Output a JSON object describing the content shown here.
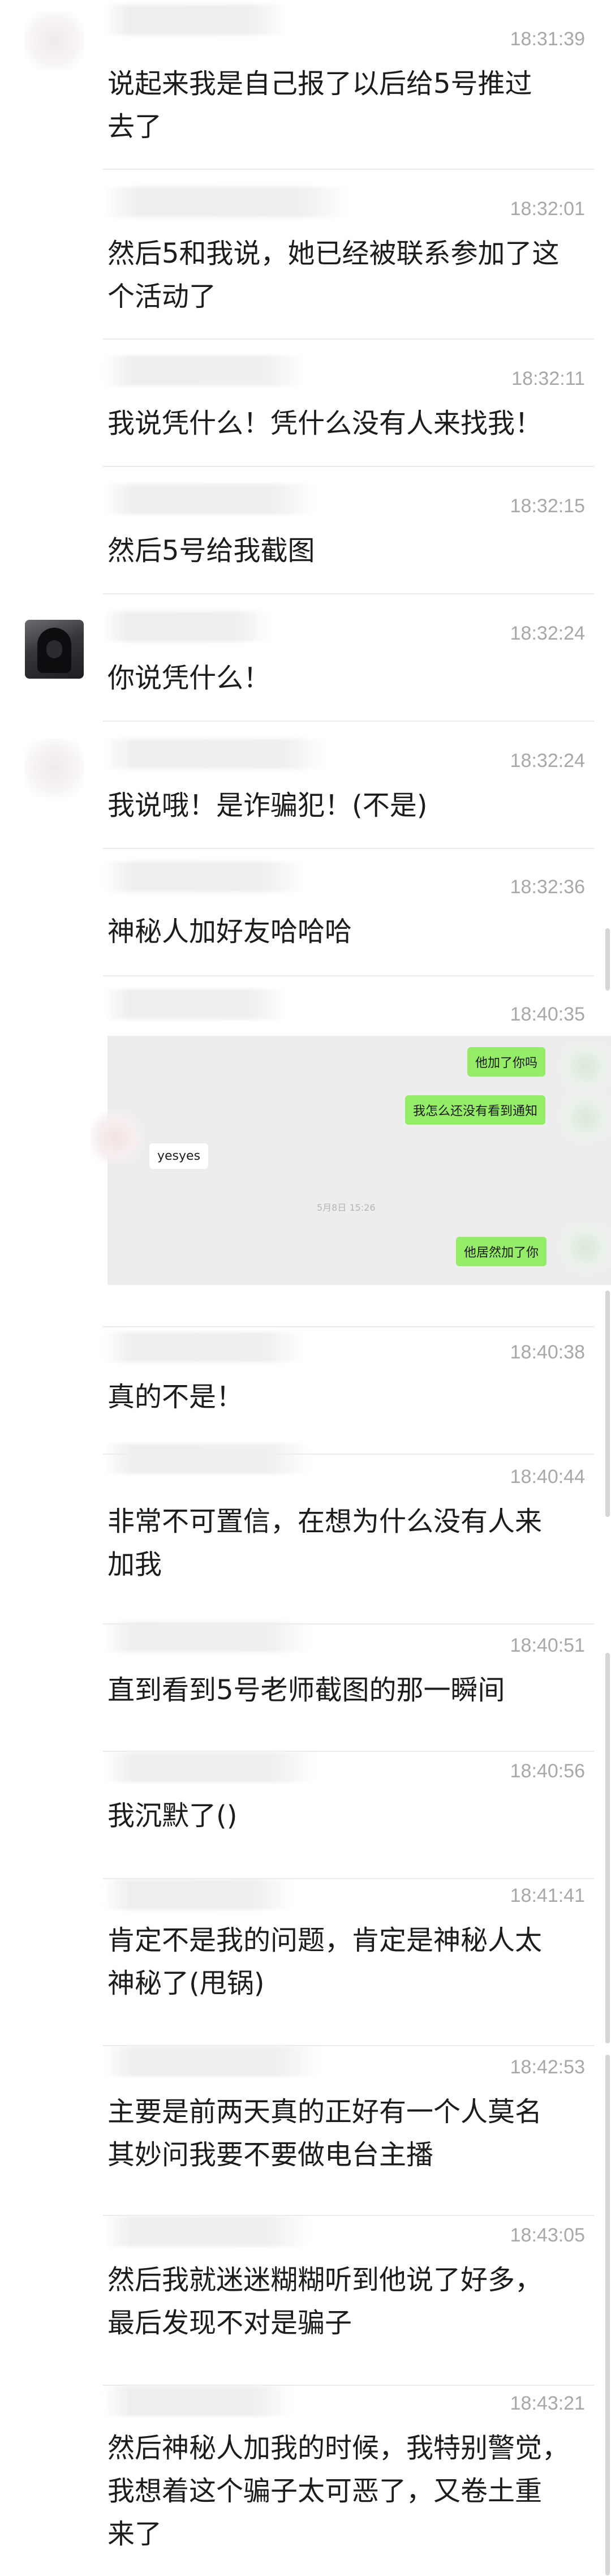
{
  "messages": [
    {
      "time": "18:31:39",
      "text": "说起来我是自己报了以后给5号推过\n去了"
    },
    {
      "time": "18:32:01",
      "text": "然后5和我说，她已经被联系参加了这\n个活动了"
    },
    {
      "time": "18:32:11",
      "text": "我说凭什么！凭什么没有人来找我！"
    },
    {
      "time": "18:32:15",
      "text": "然后5号给我截图"
    },
    {
      "time": "18:32:24",
      "text": "你说凭什么！"
    },
    {
      "time": "18:32:24",
      "text": "我说哦！是诈骗犯！(不是)"
    },
    {
      "time": "18:32:36",
      "text": "神秘人加好友哈哈哈"
    },
    {
      "time": "18:40:35",
      "text": ""
    },
    {
      "time": "18:40:38",
      "text": "真的不是！"
    },
    {
      "time": "18:40:44",
      "text": "非常不可置信，在想为什么没有人来\n加我"
    },
    {
      "time": "18:40:51",
      "text": "直到看到5号老师截图的那一瞬间"
    },
    {
      "time": "18:40:56",
      "text": "我沉默了()"
    },
    {
      "time": "18:41:41",
      "text": "肯定不是我的问题，肯定是神秘人太\n神秘了(甩锅)"
    },
    {
      "time": "18:42:53",
      "text": "主要是前两天真的正好有一个人莫名\n其妙问我要不要做电台主播"
    },
    {
      "time": "18:43:05",
      "text": "然后我就迷迷糊糊听到他说了好多，\n最后发现不对是骗子"
    },
    {
      "time": "18:43:21",
      "text": "然后神秘人加我的时候，我特别警觉，\n我想着这个骗子太可恶了，又卷土重\n来了"
    }
  ],
  "screenshot": {
    "bubbles_right": [
      "他加了你吗",
      "我怎么还没有看到通知",
      "他居然加了你"
    ],
    "bubble_left": "yesyes",
    "date_stamp": "5月8日 15:26"
  }
}
